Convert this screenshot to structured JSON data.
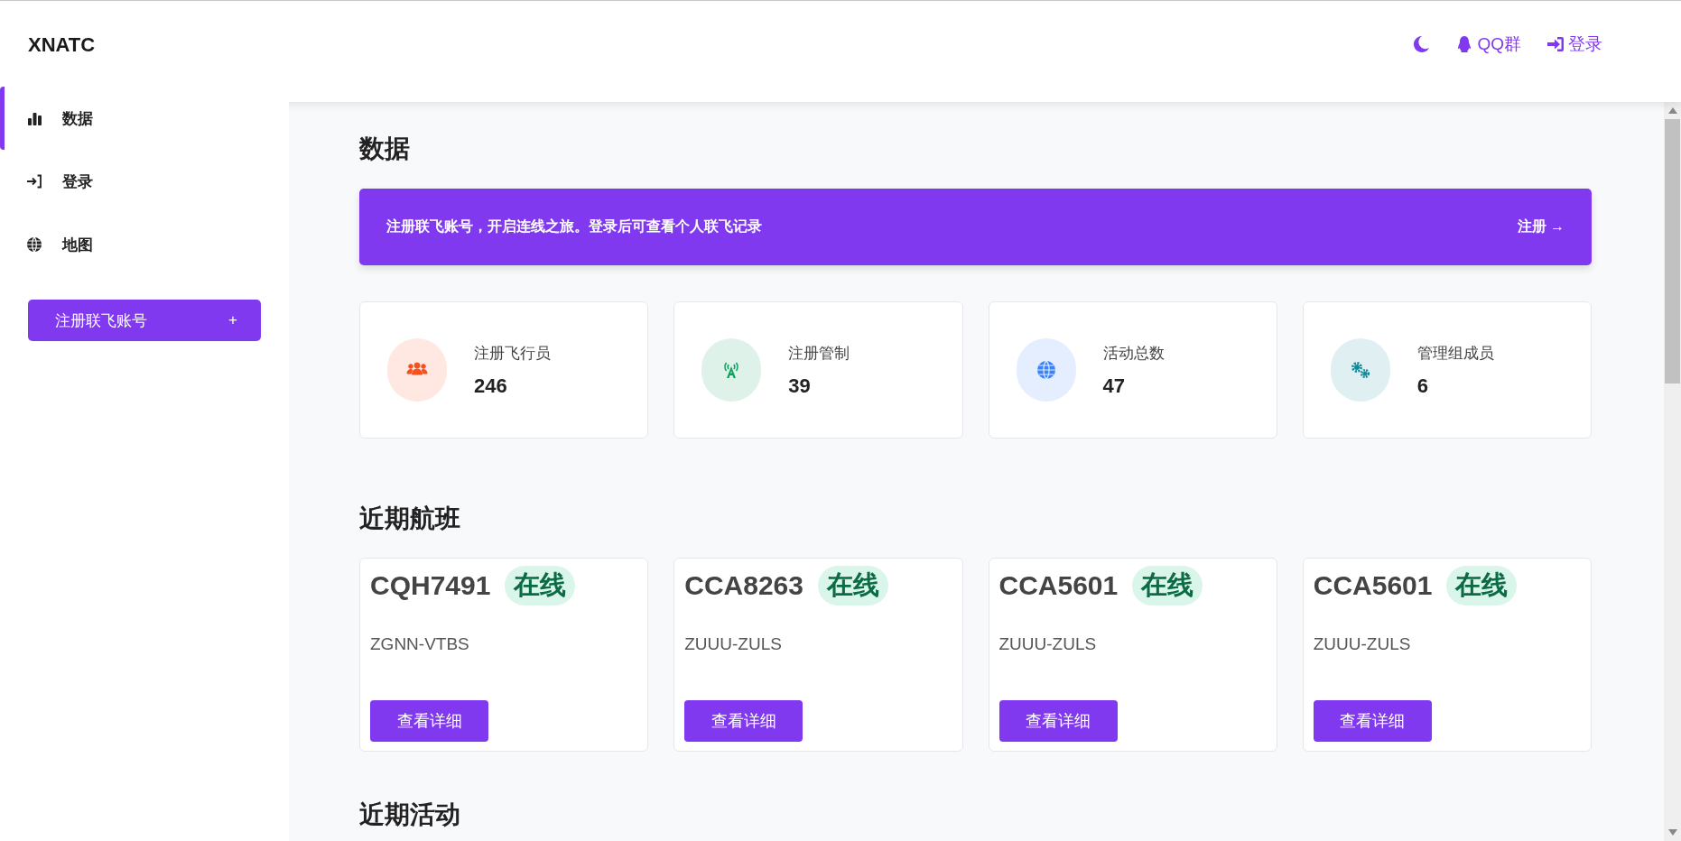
{
  "brand": "XNATC",
  "header_links": [
    {
      "kind": "theme"
    },
    {
      "kind": "qq",
      "label": "QQ群"
    },
    {
      "kind": "login",
      "label": "登录"
    }
  ],
  "sidebar": {
    "items": [
      {
        "label": "数据",
        "selected": true
      },
      {
        "label": "登录",
        "selected": false
      },
      {
        "label": "地图",
        "selected": false
      }
    ],
    "register_button": {
      "label": "注册联飞账号",
      "sign": "+"
    }
  },
  "page_title": "数据",
  "banner": {
    "text": "注册联飞账号，开启连线之旅。登录后可查看个人联飞记录",
    "link": "注册 →"
  },
  "stats": [
    {
      "label": "注册飞行员",
      "value": "246",
      "color": "#f4511e"
    },
    {
      "label": "注册管制",
      "value": "39",
      "color": "#10a060"
    },
    {
      "label": "活动总数",
      "value": "47",
      "color": "#3b82f6"
    },
    {
      "label": "管理组成员",
      "value": "6",
      "color": "#0e8a9a"
    }
  ],
  "flights_title": "近期航班",
  "flights": [
    {
      "callsign": "CQH7491",
      "status": "在线",
      "route": "ZGNN-VTBS",
      "button": "查看详细"
    },
    {
      "callsign": "CCA8263",
      "status": "在线",
      "route": "ZUUU-ZULS",
      "button": "查看详细"
    },
    {
      "callsign": "CCA5601",
      "status": "在线",
      "route": "ZUUU-ZULS",
      "button": "查看详细"
    },
    {
      "callsign": "CCA5601",
      "status": "在线",
      "route": "ZUUU-ZULS",
      "button": "查看详细"
    }
  ],
  "events_title": "近期活动"
}
